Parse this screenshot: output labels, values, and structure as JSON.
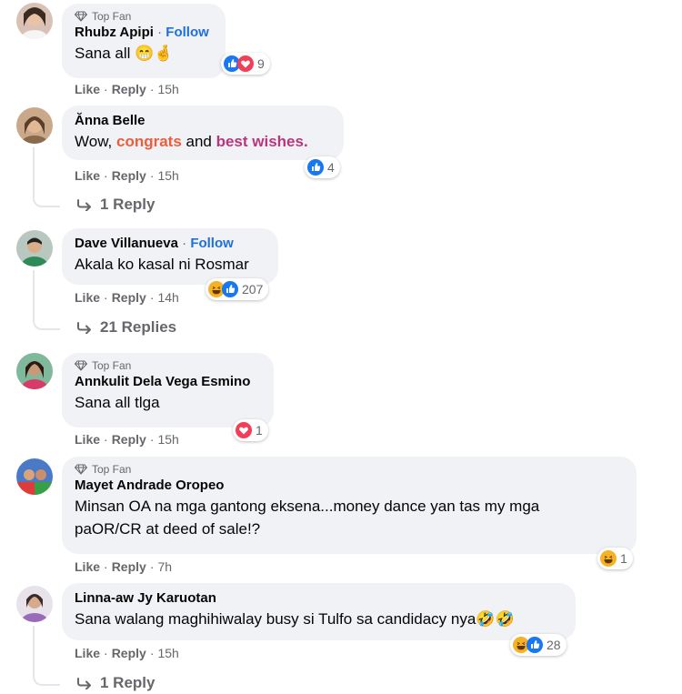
{
  "colors": {
    "link": "#216fdb",
    "muted": "#65676b",
    "bubble": "#f0f2f5",
    "orange": "#f05b39",
    "purple": "#b8367e"
  },
  "comments": [
    {
      "badge": "Top Fan",
      "name": "Rhubz Apipi",
      "sep": "·",
      "follow": "Follow",
      "text": "Sana all 😁🤞",
      "like": "Like",
      "reply": "Reply",
      "time": "15h",
      "reaction_count": "9",
      "reaction_icons": [
        "like-icon",
        "love-icon"
      ]
    },
    {
      "name": "Ănna Belle",
      "text_parts": [
        "Wow, ",
        "congrats",
        " and ",
        "best wishes."
      ],
      "like": "Like",
      "reply": "Reply",
      "time": "15h",
      "reaction_count": "4",
      "reaction_icons": [
        "like-icon"
      ],
      "replies": "1 Reply"
    },
    {
      "name": "Dave Villanueva",
      "sep": "·",
      "follow": "Follow",
      "text": "Akala ko kasal ni Rosmar",
      "like": "Like",
      "reply": "Reply",
      "time": "14h",
      "reaction_count": "207",
      "reaction_icons": [
        "haha-icon",
        "like-icon"
      ],
      "replies": "21 Replies"
    },
    {
      "badge": "Top Fan",
      "name": "Annkulit Dela Vega Esmino",
      "text": "Sana all tlga",
      "like": "Like",
      "reply": "Reply",
      "time": "15h",
      "reaction_count": "1",
      "reaction_icons": [
        "love-icon"
      ]
    },
    {
      "badge": "Top Fan",
      "name": "Mayet Andrade Oropeo",
      "text_line1": "Minsan OA na mga gantong eksena...money dance yan tas my mga",
      "text_line2": "paOR/CR at deed of sale!?",
      "like": "Like",
      "reply": "Reply",
      "time": "7h",
      "reaction_count": "1",
      "reaction_icons": [
        "haha-icon"
      ]
    },
    {
      "name": "Linna-aw Jy Karuotan",
      "text": "Sana walang maghihiwalay busy si Tulfo sa candidacy nya🤣🤣",
      "like": "Like",
      "reply": "Reply",
      "time": "15h",
      "reaction_count": "28",
      "reaction_icons": [
        "haha-icon",
        "like-icon"
      ],
      "replies": "1 Reply"
    }
  ]
}
